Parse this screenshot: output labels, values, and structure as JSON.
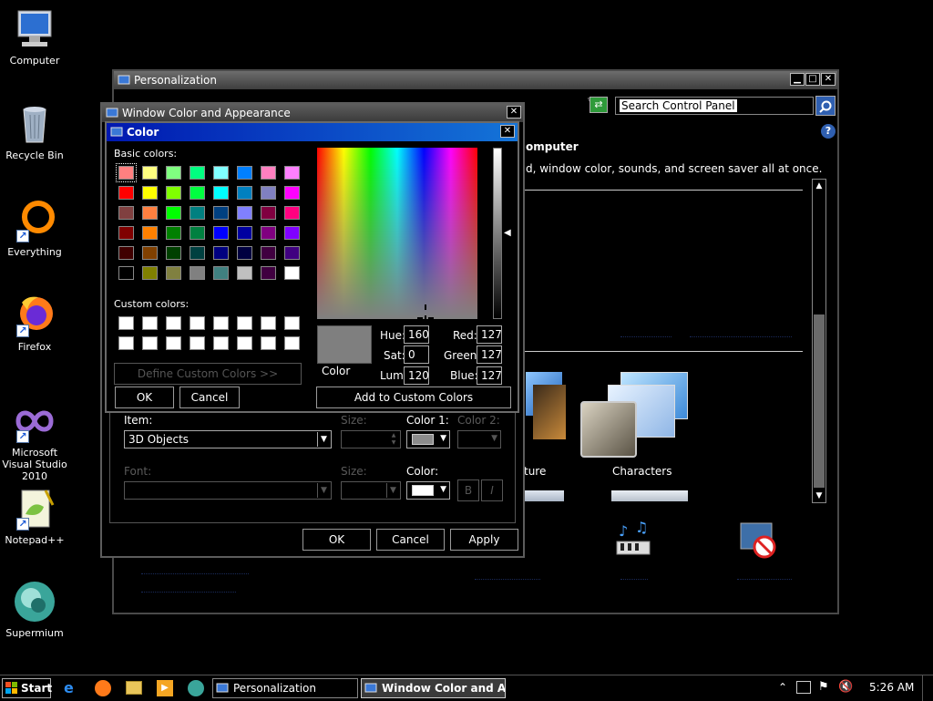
{
  "desktop": {
    "icons": [
      {
        "label": "Computer"
      },
      {
        "label": "Recycle Bin"
      },
      {
        "label": "Everything"
      },
      {
        "label": "Firefox"
      },
      {
        "label": "Microsoft Visual Studio 2010"
      },
      {
        "label": "Notepad++"
      },
      {
        "label": "Supermium"
      }
    ]
  },
  "personalization": {
    "title": "Personalization",
    "search_placeholder": "Search Control Panel",
    "heading_partial": "omputer",
    "subtext_partial": "d, window color, sounds, and screen saver all at once.",
    "themes": [
      {
        "label": "ture"
      },
      {
        "label": "Characters"
      }
    ]
  },
  "wca": {
    "title": "Window Color and Appearance",
    "item_label": "Item:",
    "item_value": "3D Objects",
    "size_label": "Size:",
    "color1_label": "Color 1:",
    "color2_label": "Color 2:",
    "font_label": "Font:",
    "font_size_label": "Size:",
    "font_color_label": "Color:",
    "bold": "B",
    "italic": "I",
    "ok": "OK",
    "cancel": "Cancel",
    "apply": "Apply"
  },
  "color_dialog": {
    "title": "Color",
    "basic_colors_label": "Basic colors:",
    "custom_colors_label": "Custom colors:",
    "define_custom": "Define Custom Colors >>",
    "ok": "OK",
    "cancel": "Cancel",
    "add_custom": "Add to Custom Colors",
    "color_label": "Color",
    "hue_label": "Hue:",
    "hue": "160",
    "sat_label": "Sat:",
    "sat": "0",
    "lum_label": "Lum:",
    "lum": "120",
    "red_label": "Red:",
    "red": "127",
    "green_label": "Green:",
    "green": "127",
    "blue_label": "Blue:",
    "blue": "127",
    "preview_color": "#7f7f7f",
    "basic_colors": [
      "#ff8080",
      "#ffff80",
      "#80ff80",
      "#00ff80",
      "#80ffff",
      "#0080ff",
      "#ff80c0",
      "#ff80ff",
      "#ff0000",
      "#ffff00",
      "#80ff00",
      "#00ff40",
      "#00ffff",
      "#0080c0",
      "#8080c0",
      "#ff00ff",
      "#804040",
      "#ff8040",
      "#00ff00",
      "#008080",
      "#004080",
      "#8080ff",
      "#800040",
      "#ff0080",
      "#800000",
      "#ff8000",
      "#008000",
      "#008040",
      "#0000ff",
      "#0000a0",
      "#800080",
      "#8000ff",
      "#400000",
      "#804000",
      "#004000",
      "#004040",
      "#000080",
      "#000040",
      "#400040",
      "#400080",
      "#000000",
      "#808000",
      "#808040",
      "#808080",
      "#408080",
      "#c0c0c0",
      "#400040",
      "#ffffff"
    ]
  },
  "taskbar": {
    "start": "Start",
    "tasks": [
      {
        "label": "Personalization"
      },
      {
        "label": "Window Color and Ap..."
      }
    ],
    "clock": "5:26 AM"
  }
}
